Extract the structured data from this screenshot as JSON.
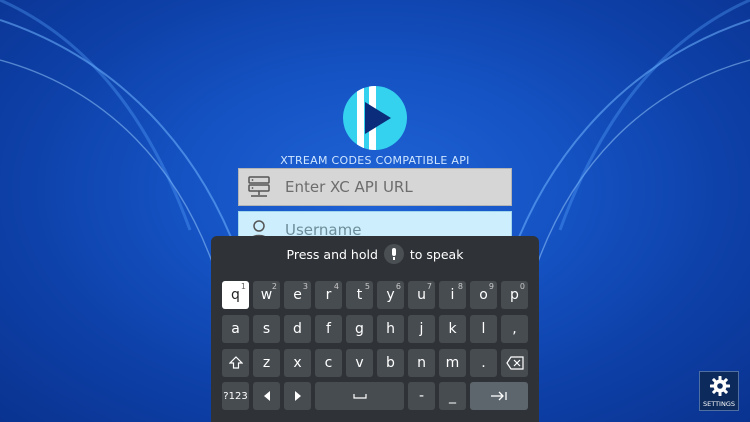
{
  "app": {
    "subtitle": "XTREAM CODES COMPATIBLE API",
    "accent": "#35d2f0"
  },
  "form": {
    "url_placeholder": "Enter XC API URL",
    "username_placeholder": "Username"
  },
  "keyboard": {
    "hint_before": "Press and hold",
    "hint_after": "to speak",
    "row1": [
      {
        "label": "q",
        "sup": "1"
      },
      {
        "label": "w",
        "sup": "2"
      },
      {
        "label": "e",
        "sup": "3"
      },
      {
        "label": "r",
        "sup": "4"
      },
      {
        "label": "t",
        "sup": "5"
      },
      {
        "label": "y",
        "sup": "6"
      },
      {
        "label": "u",
        "sup": "7"
      },
      {
        "label": "i",
        "sup": "8"
      },
      {
        "label": "o",
        "sup": "9"
      },
      {
        "label": "p",
        "sup": "0"
      }
    ],
    "row2": [
      "a",
      "s",
      "d",
      "f",
      "g",
      "h",
      "j",
      "k",
      "l",
      ","
    ],
    "row3": [
      "z",
      "x",
      "c",
      "v",
      "b",
      "n",
      "m",
      "."
    ],
    "symbols_label": "?123",
    "row4_extra": [
      "-",
      "_"
    ]
  },
  "settings": {
    "label": "SETTINGS"
  }
}
